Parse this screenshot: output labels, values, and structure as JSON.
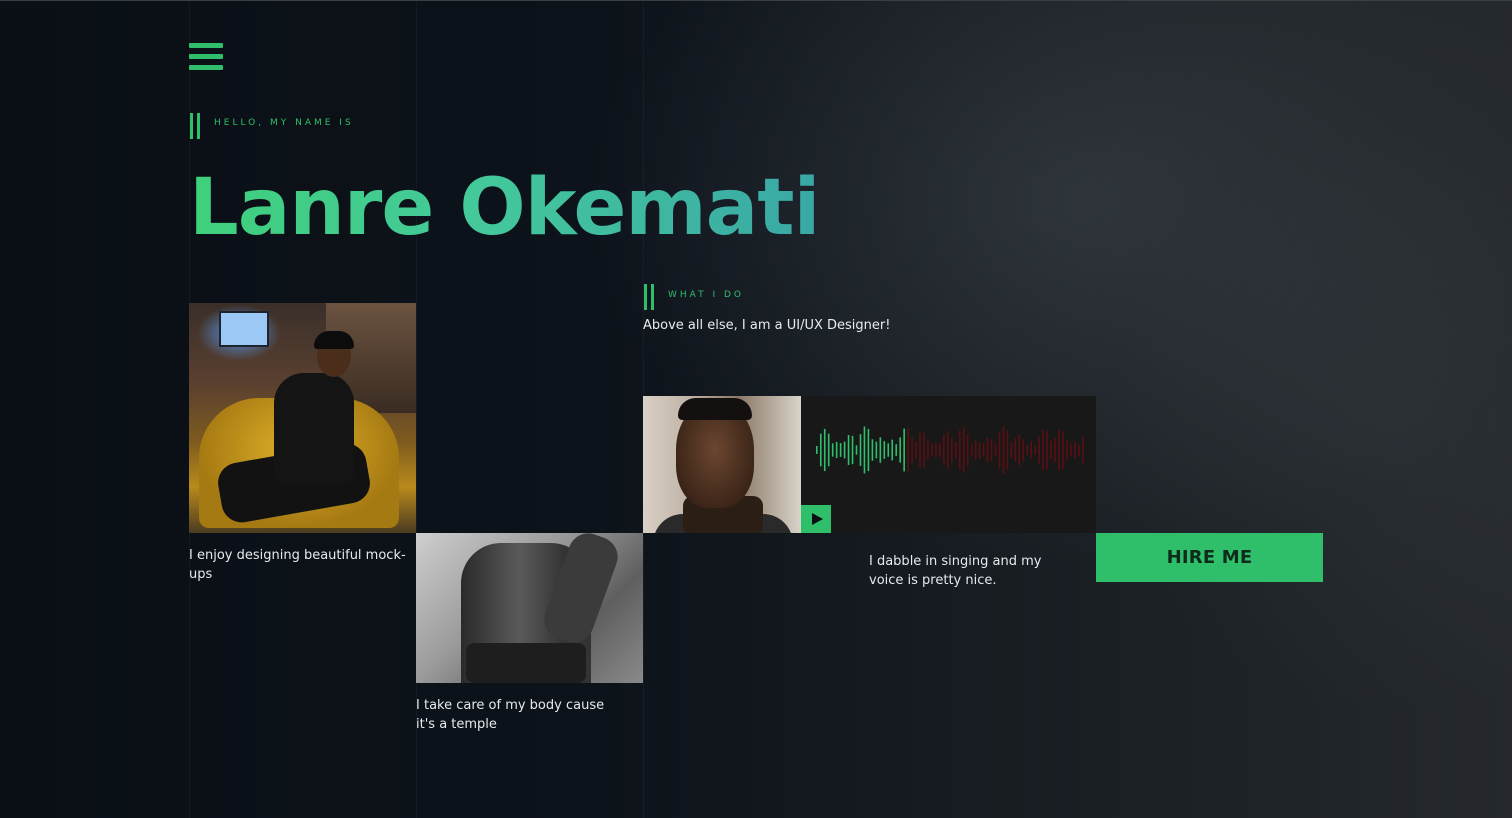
{
  "greeting": "HELLO, MY NAME IS",
  "name": "Lanre Okemati",
  "what_i_do": {
    "eyebrow": "WHAT I DO",
    "lead": "Above all else, I am a UI/UX Designer!"
  },
  "captions": {
    "design": "I enjoy designing beautiful mock-ups",
    "body": "I take care of my body cause it's a temple",
    "voice": "I dabble in singing and my voice is pretty nice."
  },
  "hire_button": "HIRE ME",
  "colors": {
    "accent": "#2fbf6a",
    "background": "#0d1219",
    "waveform_played": "#2fbf6a",
    "waveform_unplayed": "#5a0f12"
  },
  "icons": {
    "menu": "hamburger-menu-icon",
    "play": "play-icon"
  },
  "audio": {
    "progress": 0.33
  }
}
